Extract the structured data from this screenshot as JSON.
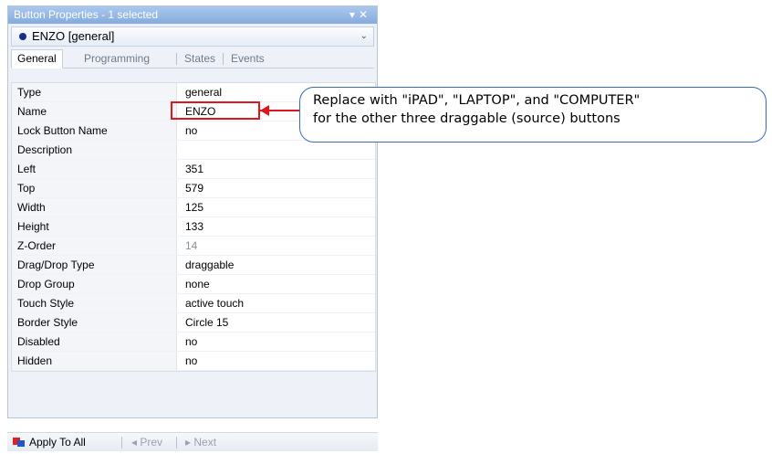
{
  "window": {
    "title": "Button Properties - 1 selected",
    "pin_icon": "pin-icon",
    "close_icon": "close-icon"
  },
  "selector": {
    "value": "ENZO  [general]",
    "dot_color": "#1b2a8c"
  },
  "tabs": [
    {
      "label": "General",
      "active": true
    },
    {
      "label": "Programming",
      "active": false
    },
    {
      "label": "States",
      "active": false
    },
    {
      "label": "Events",
      "active": false
    }
  ],
  "properties": [
    {
      "name": "Type",
      "value": "general"
    },
    {
      "name": "Name",
      "value": "ENZO"
    },
    {
      "name": "Lock Button Name",
      "value": "no"
    },
    {
      "name": "Description",
      "value": ""
    },
    {
      "name": "Left",
      "value": "351"
    },
    {
      "name": "Top",
      "value": "579"
    },
    {
      "name": "Width",
      "value": "125"
    },
    {
      "name": "Height",
      "value": "133"
    },
    {
      "name": "Z-Order",
      "value": "14"
    },
    {
      "name": "Drag/Drop Type",
      "value": "draggable"
    },
    {
      "name": "Drop Group",
      "value": "none"
    },
    {
      "name": "Touch Style",
      "value": "active touch"
    },
    {
      "name": "Border Style",
      "value": "Circle 15"
    },
    {
      "name": "Disabled",
      "value": "no"
    },
    {
      "name": "Hidden",
      "value": "no"
    }
  ],
  "bottombar": {
    "apply_label": "Apply To All",
    "prev_label": "Prev",
    "next_label": "Next"
  },
  "callout": {
    "line1": "Replace with \"iPAD\", \"LAPTOP\", and \"COMPUTER\"",
    "line2": "for the other three draggable (source) buttons",
    "accent_color": "#e0161e",
    "border_color": "#3b69b5"
  }
}
